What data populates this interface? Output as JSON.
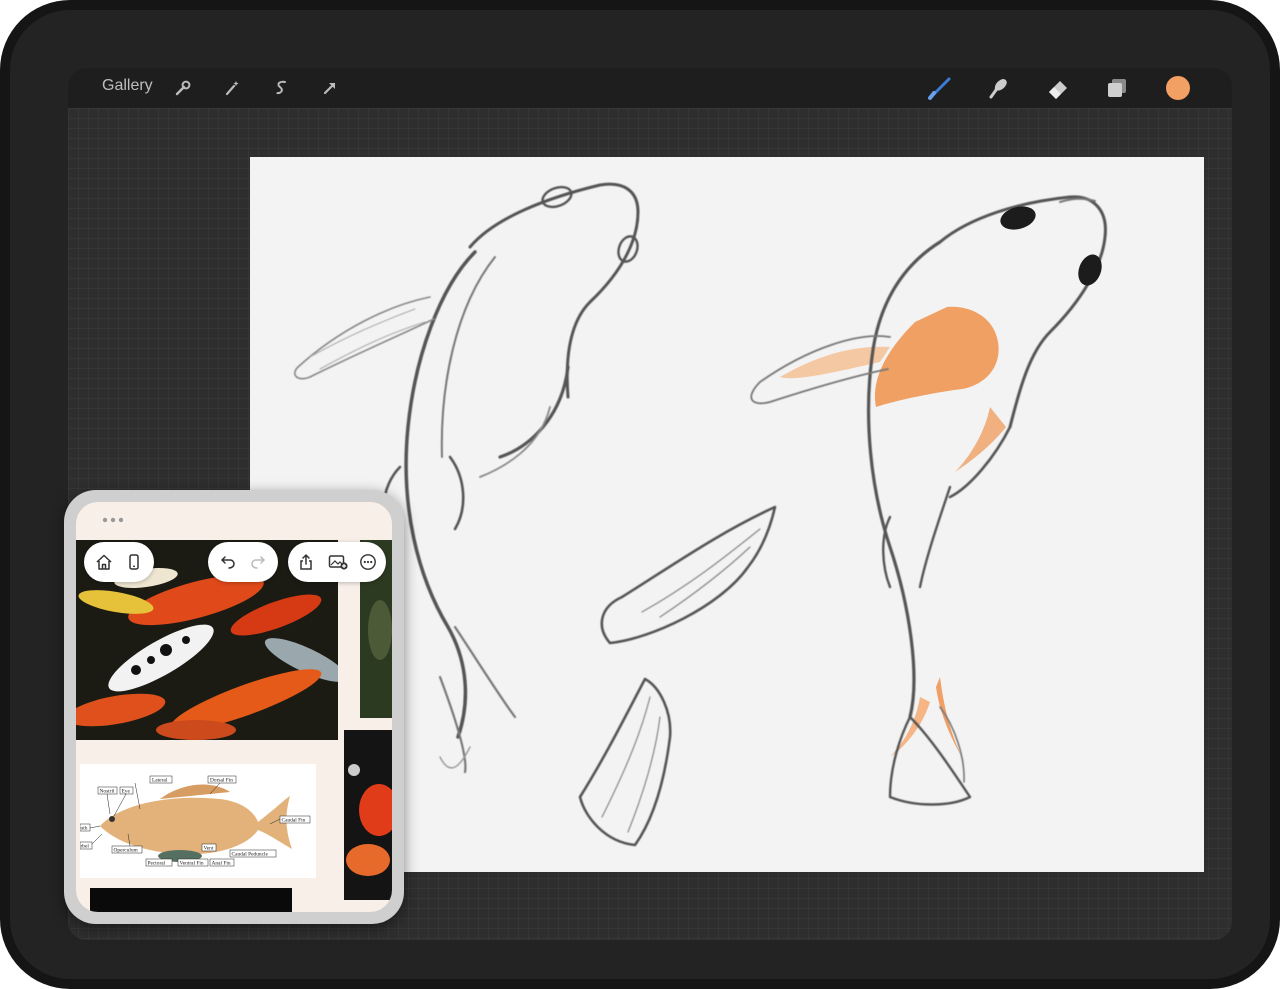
{
  "app": {
    "gallery_label": "Gallery",
    "toolbar_left": [
      "wrench-icon",
      "magic-wand-icon",
      "selection-icon",
      "transform-arrow-icon"
    ],
    "toolbar_right": [
      "brush-icon",
      "smudge-icon",
      "eraser-icon",
      "layers-icon",
      "color-swatch"
    ],
    "active_color": "#f2a063",
    "active_tool_color": "#3d7bd6"
  },
  "reference_window": {
    "toolbar": [
      "home-icon",
      "phone-icon",
      "undo-icon",
      "redo-icon",
      "share-icon",
      "add-image-icon",
      "more-icon"
    ],
    "diagram_labels": {
      "lateral": "Lateral",
      "dorsal_fin": "Dorsal Fin",
      "nostril": "Nostril",
      "eye": "Eye",
      "caudal_fin": "Caudal Fin",
      "operculum": "Operculum",
      "vent": "Vent",
      "caudal_peduncle": "Caudal Peduncle",
      "pectoral": "Pectoral",
      "ventral_fin": "Ventral Fin",
      "anal_fin": "Anal Fin",
      "mouth_partial": "uth",
      "barbel_partial": "rbel"
    }
  }
}
